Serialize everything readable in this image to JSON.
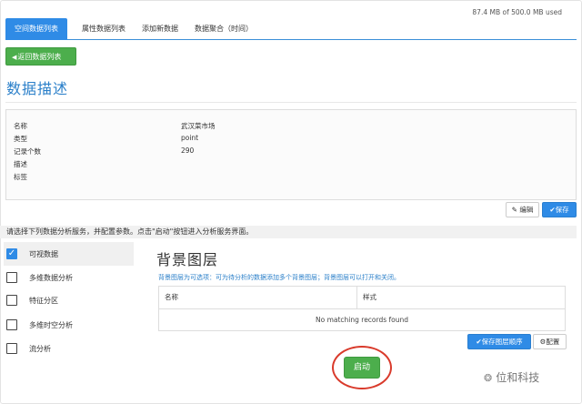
{
  "storage": "87.4 MB of 500.0 MB used",
  "tabs": [
    {
      "label": "空间数据列表",
      "active": true
    },
    {
      "label": "属性数据列表",
      "active": false
    },
    {
      "label": "添加新数据",
      "active": false
    },
    {
      "label": "数据聚合（时间）",
      "active": false
    }
  ],
  "back_button": {
    "icon": "chevron-left-icon",
    "label": "返回数据列表"
  },
  "page_title": "数据描述",
  "info": {
    "rows": [
      {
        "label": "名称",
        "value": "武汉菜市场"
      },
      {
        "label": "类型",
        "value": "point"
      },
      {
        "label": "记录个数",
        "value": "290"
      },
      {
        "label": "描述",
        "value": ""
      },
      {
        "label": "标签",
        "value": ""
      }
    ]
  },
  "actions": {
    "edit_icon": "edit-icon",
    "edit_label": "编辑",
    "save_icon": "check-icon",
    "save_label": "保存"
  },
  "instruction": "请选择下列数据分析服务，并配置参数。点击\"启动\"按钮进入分析服务界面。",
  "services": [
    {
      "label": "可视数据",
      "checked": true
    },
    {
      "label": "多维数据分析",
      "checked": false
    },
    {
      "label": "特征分区",
      "checked": false
    },
    {
      "label": "多维时空分析",
      "checked": false
    },
    {
      "label": "流分析",
      "checked": false
    }
  ],
  "background": {
    "title": "背景图层",
    "help": "背景图层为可选项：可为待分析的数据添加多个背景图层；背景图层可以打开和关闭。",
    "columns": [
      "名称",
      "样式"
    ],
    "empty_text": "No matching records found",
    "save_order_label": "保存图层顺序",
    "config_label": "配置"
  },
  "start_label": "启动",
  "watermark": "位和科技",
  "colors": {
    "primary": "#2f8be6",
    "success": "#4cae4c",
    "title": "#2a7fc9",
    "highlight": "#d93a2b"
  }
}
